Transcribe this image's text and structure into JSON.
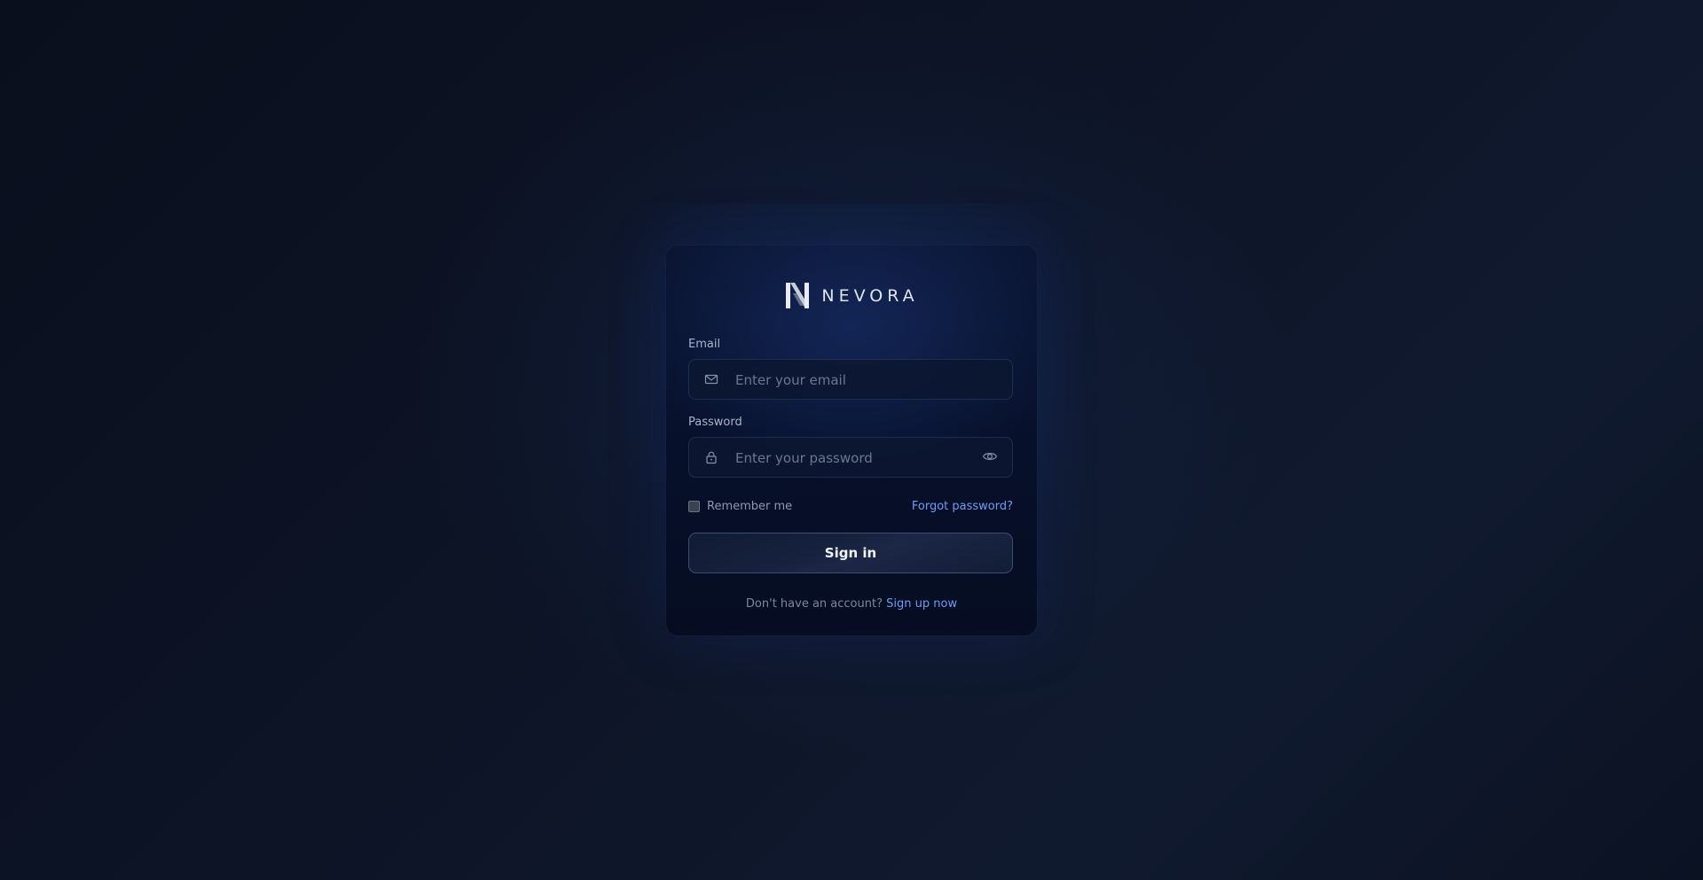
{
  "brand": {
    "name": "NEVORA",
    "logo_icon": "n-monogram-icon"
  },
  "form": {
    "email": {
      "label": "Email",
      "placeholder": "Enter your email",
      "value": "",
      "icon": "mail-icon"
    },
    "password": {
      "label": "Password",
      "placeholder": "Enter your password",
      "value": "",
      "icon": "lock-icon",
      "toggle_icon": "eye-icon"
    },
    "remember_label": "Remember me",
    "remember_checked": false,
    "forgot_label": "Forgot password?",
    "submit_label": "Sign in"
  },
  "signup": {
    "prompt": "Don't have an account?",
    "link_label": "Sign up now"
  },
  "colors": {
    "background": "#0d1426",
    "card": "#07102a",
    "link": "#6f9bf2",
    "text_muted": "#8e99ae"
  }
}
